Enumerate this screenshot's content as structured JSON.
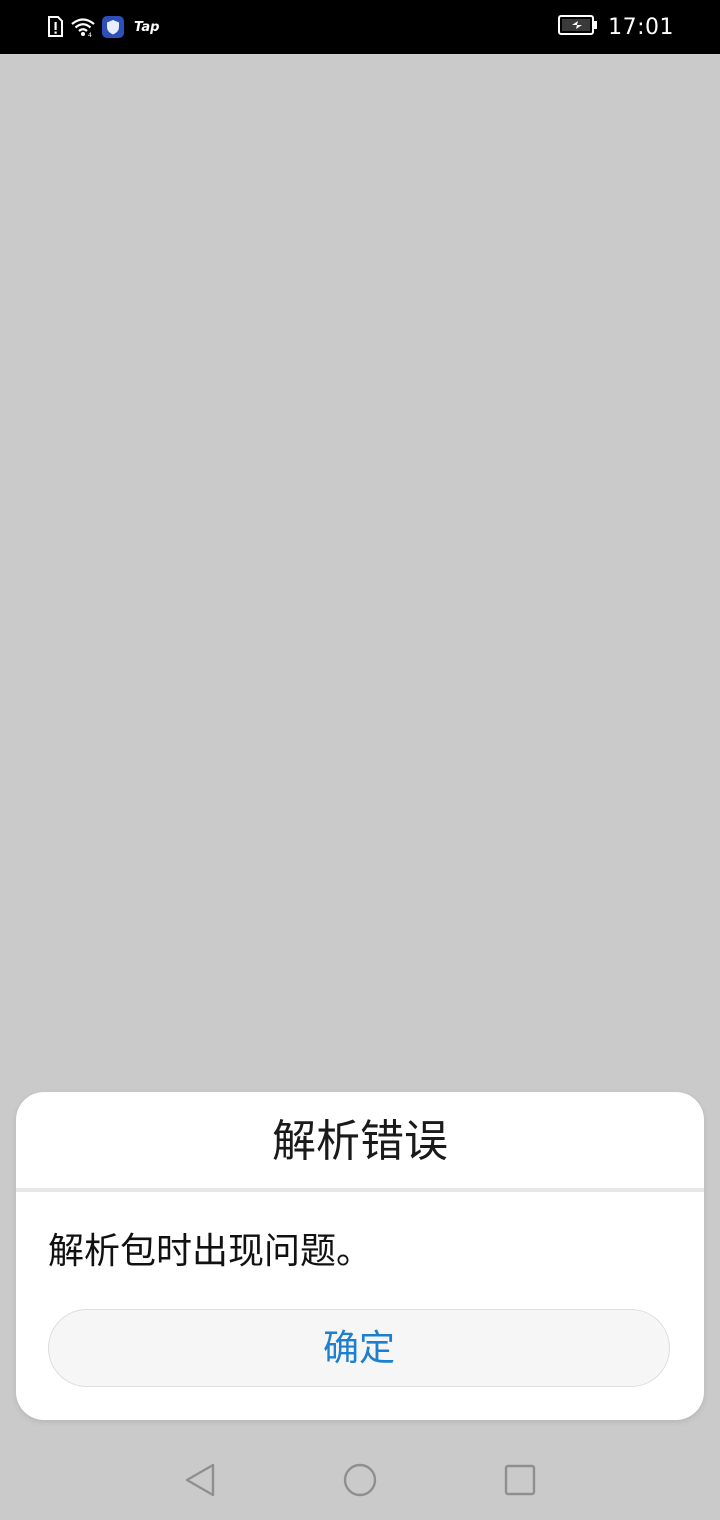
{
  "status_bar": {
    "time": "17:01",
    "app_label": "Tap",
    "icons": [
      "sim-alert-icon",
      "wifi-icon",
      "shield-app-icon",
      "tap-app-icon",
      "battery-charging-icon"
    ]
  },
  "dialog": {
    "title": "解析错误",
    "message": "解析包时出现问题。",
    "confirm_label": "确定"
  },
  "nav_bar": {
    "icons": [
      "back-icon",
      "home-icon",
      "recent-apps-icon"
    ]
  },
  "colors": {
    "background": "#cacaca",
    "status_bar": "#000000",
    "dialog": "#ffffff",
    "button_text": "#1d7fd1",
    "button_bg": "#f6f6f6"
  }
}
